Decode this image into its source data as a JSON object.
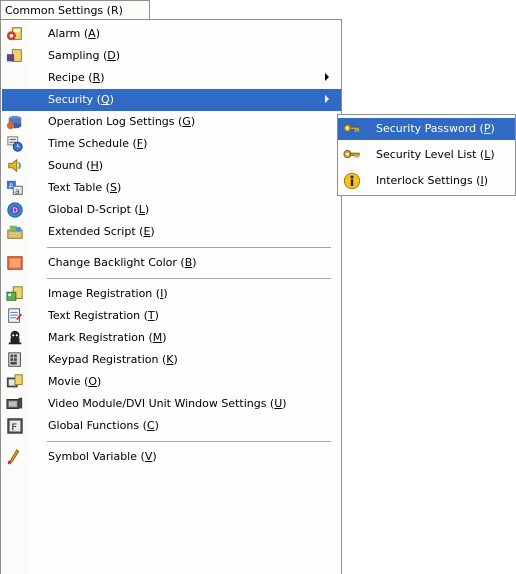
{
  "menubar": {
    "label": "Common Settings (R)"
  },
  "menu": {
    "items": [
      {
        "name": "Alarm",
        "key": "A",
        "icon": "alarm-icon"
      },
      {
        "name": "Sampling",
        "key": "D",
        "icon": "sampling-icon"
      },
      {
        "name": "Recipe",
        "key": "R",
        "icon": "",
        "submenu": true
      },
      {
        "name": "Security",
        "key": "Q",
        "icon": "",
        "submenu": true,
        "highlighted": true
      },
      {
        "name": "Operation Log Settings",
        "key": "G",
        "icon": "operation-log-icon"
      },
      {
        "name": "Time Schedule",
        "key": "F",
        "icon": "time-schedule-icon"
      },
      {
        "name": "Sound",
        "key": "H",
        "icon": "sound-icon"
      },
      {
        "name": "Text Table",
        "key": "S",
        "icon": "text-table-icon"
      },
      {
        "name": "Global D-Script",
        "key": "L",
        "icon": "global-d-script-icon"
      },
      {
        "name": "Extended Script",
        "key": "E",
        "icon": "extended-script-icon"
      },
      {
        "name": "Change Backlight Color",
        "key": "B",
        "icon": "backlight-color-icon"
      },
      {
        "name": "Image Registration",
        "key": "I",
        "icon": "image-registration-icon"
      },
      {
        "name": "Text Registration",
        "key": "T",
        "icon": "text-registration-icon"
      },
      {
        "name": "Mark Registration",
        "key": "M",
        "icon": "mark-registration-icon"
      },
      {
        "name": "Keypad Registration",
        "key": "K",
        "icon": "keypad-registration-icon"
      },
      {
        "name": "Movie",
        "key": "O",
        "icon": "movie-icon"
      },
      {
        "name": "Video Module/DVI Unit Window Settings",
        "key": "U",
        "icon": "video-module-icon"
      },
      {
        "name": "Global Functions",
        "key": "C",
        "icon": "global-functions-icon"
      },
      {
        "name": "Symbol Variable",
        "key": "V",
        "icon": "symbol-variable-icon"
      }
    ]
  },
  "submenu": {
    "items": [
      {
        "name": "Security Password",
        "key": "P",
        "icon": "key-icon",
        "highlighted": true
      },
      {
        "name": "Security Level List",
        "key": "L",
        "icon": "key-icon"
      },
      {
        "name": "Interlock Settings",
        "key": "I",
        "icon": "info-icon"
      }
    ]
  },
  "colors": {
    "highlight": "#316ac5",
    "separator": "#a6a6a6",
    "border": "#8e8e8e"
  }
}
